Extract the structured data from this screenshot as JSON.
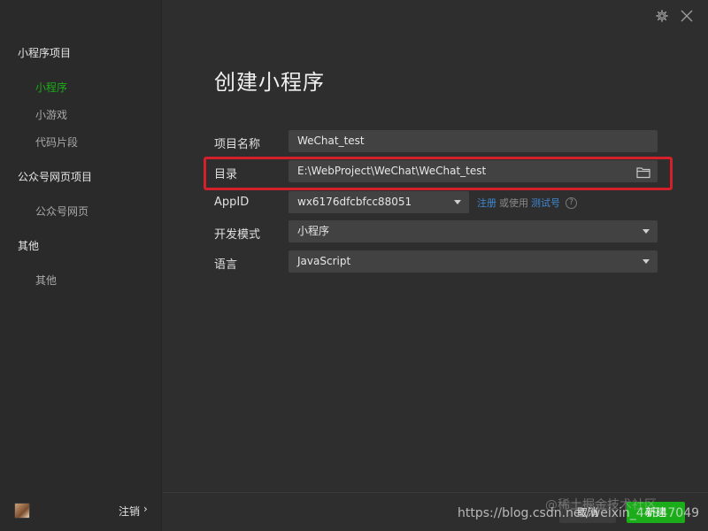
{
  "sidebar": {
    "sections": [
      {
        "title": "小程序项目",
        "items": [
          "小程序",
          "小游戏",
          "代码片段"
        ]
      },
      {
        "title": "公众号网页项目",
        "items": [
          "公众号网页"
        ]
      },
      {
        "title": "其他",
        "items": [
          "其他"
        ]
      }
    ],
    "active_item": "小程序",
    "logout_label": "注销",
    "logout_chevron": "›"
  },
  "top_icons": {
    "settings": "gear-icon",
    "close": "close-icon"
  },
  "page_title": "创建小程序",
  "form": {
    "project_name": {
      "label": "项目名称",
      "value": "WeChat_test"
    },
    "directory": {
      "label": "目录",
      "value": "E:\\WebProject\\WeChat\\WeChat_test"
    },
    "appid": {
      "label": "AppID",
      "value": "wx6176dfcbfcc88051",
      "register_link": "注册",
      "or_use_text": "或使用",
      "test_link": "测试号",
      "help": "?"
    },
    "dev_mode": {
      "label": "开发模式",
      "value": "小程序"
    },
    "language": {
      "label": "语言",
      "value": "JavaScript"
    }
  },
  "buttons": {
    "cancel": "取消",
    "create": "新建"
  },
  "watermarks": {
    "juejin": "@稀土掘金技术社区",
    "csdn": "https://blog.csdn.net/weixin_44947049"
  },
  "colors": {
    "accent_green": "#1aad19",
    "link_blue": "#3e8ad6",
    "highlight_red": "#d4202a"
  }
}
